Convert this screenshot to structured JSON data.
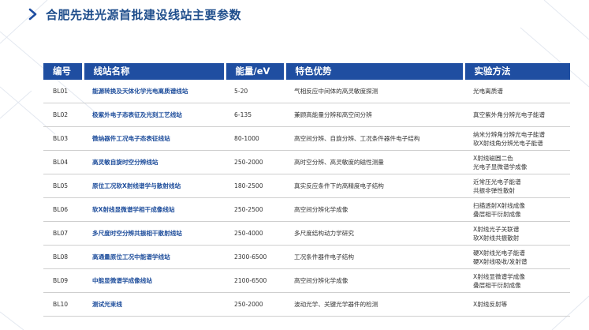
{
  "title": "合肥先进光源首批建设线站主要参数",
  "colors": {
    "accent": "#1f4ea1",
    "title": "#1f4e8c",
    "name": "#1f4e9c"
  },
  "headers": {
    "id": "编号",
    "name": "线站名称",
    "energy": "能量/eV",
    "feature": "特色优势",
    "method": "实验方法"
  },
  "rows": [
    {
      "id": "BL01",
      "name": "能源转换及天体化学光电离质谱线站",
      "energy": "5-20",
      "feature": "气相反应中间体的高灵敏度探测",
      "method": [
        "光电离质谱"
      ]
    },
    {
      "id": "BL02",
      "name": "极紫外电子态表征及光刻工艺线站",
      "energy": "6-135",
      "feature": "兼顾高能量分辨和高空间分辨",
      "method": [
        "真空紫外角分辨光电子能谱"
      ]
    },
    {
      "id": "BL03",
      "name": "微纳器件工况电子态表征线站",
      "energy": "80-1000",
      "feature": "高空间分辨、自旋分辨、工况条件器件电子结构",
      "method": [
        "纳米分辨角分辨光电子能谱",
        "软X射线角分辨光电子能谱"
      ]
    },
    {
      "id": "BL04",
      "name": "高灵敏自旋时空分辨线站",
      "energy": "250-2000",
      "feature": "高时空分辨、高灵敏度的磁性测量",
      "method": [
        "X射线磁圆二色",
        "光电子显微谱学成像"
      ]
    },
    {
      "id": "BL05",
      "name": "原位工况软X射线谱学与散射线站",
      "energy": "180-2500",
      "feature": "真实反应条件下的高精度电子结构",
      "method": [
        "近常压光电子能谱",
        "共振非弹性散射"
      ]
    },
    {
      "id": "BL06",
      "name": "软X射线显微谱学相干成像线站",
      "energy": "250-2500",
      "feature": "高空间分辨化学成像",
      "method": [
        "扫描透射X射线成像",
        "叠层相干衍射成像"
      ]
    },
    {
      "id": "BL07",
      "name": "多尺度时空分辨共振相干散射线站",
      "energy": "250-4000",
      "feature": "多尺度结构动力学研究",
      "method": [
        "X射线光子关联谱",
        "软X射线共振散射"
      ]
    },
    {
      "id": "BL08",
      "name": "高通量原位工况中能谱学线站",
      "energy": "2300-6500",
      "feature": "工况条件器件电子结构",
      "method": [
        "硬X射线光电子能谱",
        "硬X射线吸收/发射谱"
      ]
    },
    {
      "id": "BL09",
      "name": "中能显微谱学成像线站",
      "energy": "2100-6500",
      "feature": "高空间分辨化学成像",
      "method": [
        "X射线显微谱学成像",
        "叠层相干衍射成像"
      ]
    },
    {
      "id": "BL10",
      "name": "测试光束线",
      "energy": "250-2000",
      "feature": "波动光学、关键光学器件的检测",
      "method": [
        "X射线反射等"
      ]
    }
  ]
}
